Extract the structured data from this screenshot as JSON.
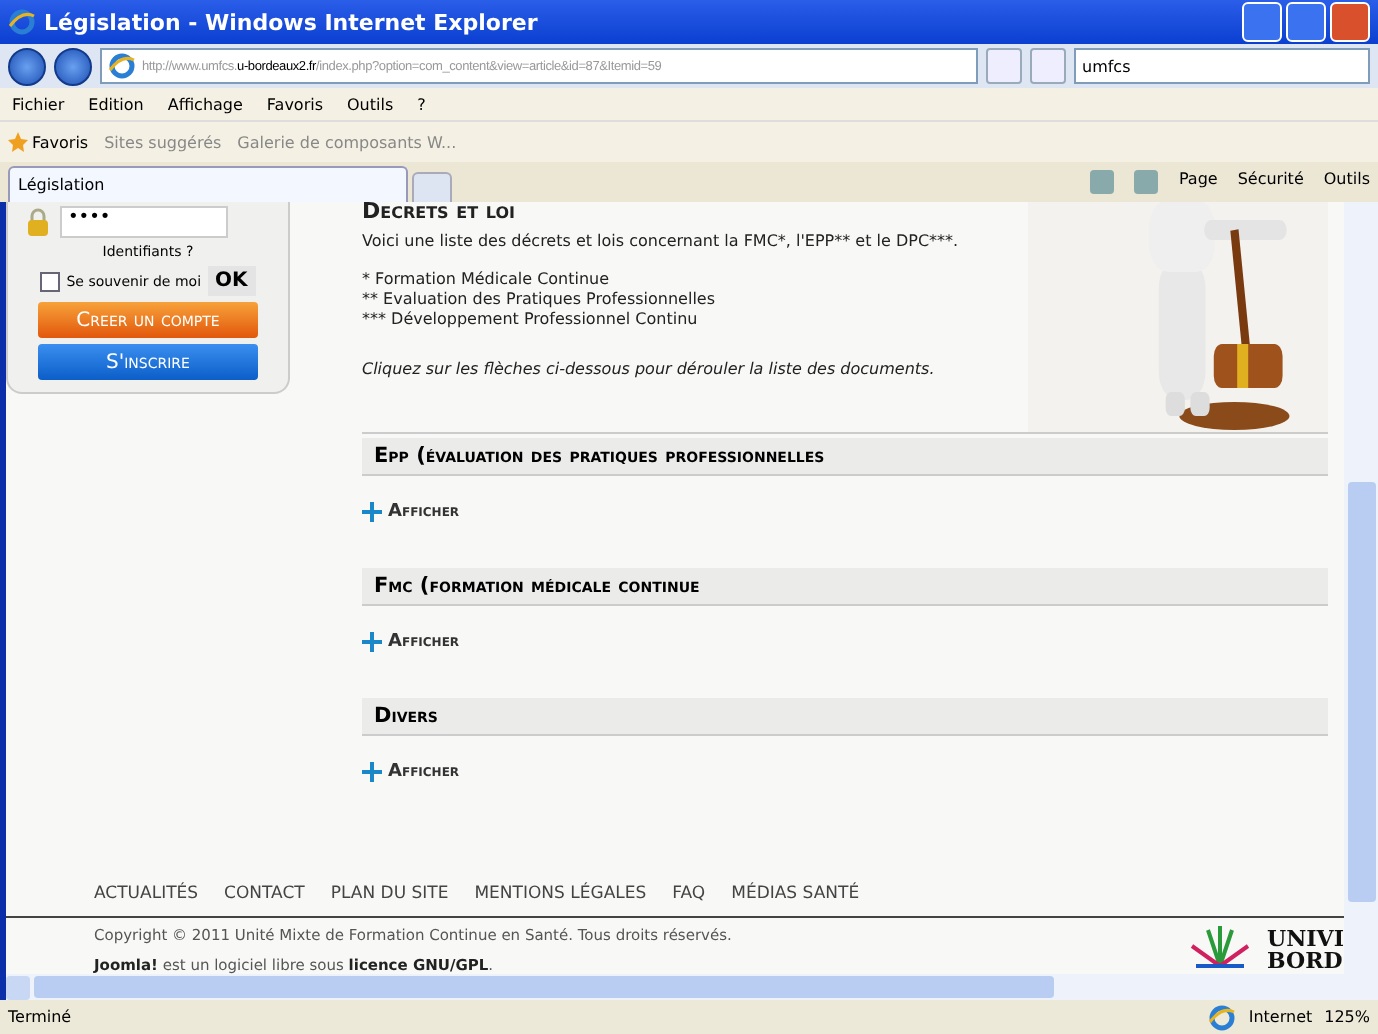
{
  "window": {
    "title": "Législation - Windows Internet Explorer"
  },
  "address": {
    "prefix": "http://www.umfcs.",
    "host": "u-bordeaux2.fr",
    "path": "/index.php?option=com_content&view=article&id=87&Itemid=59"
  },
  "search": {
    "value": "umfcs"
  },
  "menu": [
    "Fichier",
    "Edition",
    "Affichage",
    "Favoris",
    "Outils",
    "?"
  ],
  "favorites_bar": {
    "label": "Favoris",
    "links": [
      {
        "label": "Sites suggérés"
      },
      {
        "label": "Galerie de composants W..."
      }
    ]
  },
  "tabs": [
    {
      "label": "Législation",
      "selected": true
    }
  ],
  "command_bar": [
    "Page",
    "Sécurité",
    "Outils"
  ],
  "login": {
    "password": "••••",
    "forgot": "Identifiants ?",
    "remember": {
      "label": "Se souvenir de moi",
      "checked": false
    },
    "ok": "OK",
    "buttons": [
      {
        "label": "Creer un compte",
        "kind": "orange"
      },
      {
        "label": "S'inscrire",
        "kind": "blue"
      }
    ]
  },
  "article": {
    "title": "Decrets et loi",
    "intro": "Voici une liste des décrets et lois concernant la FMC*, l'EPP** et le DPC***.",
    "notes": [
      "* Formation Médicale Continue",
      "** Evaluation des Pratiques Professionnelles",
      "*** Développement Professionnel Continu"
    ],
    "hint": "Cliquez sur les flèches ci-dessous pour dérouler la liste des documents."
  },
  "sections": [
    {
      "title": "Epp (évaluation des pratiques professionnelles",
      "action": "Afficher"
    },
    {
      "title": "Fmc (formation médicale continue",
      "action": "Afficher"
    },
    {
      "title": "Divers",
      "action": "Afficher"
    }
  ],
  "footer": {
    "links": [
      "ACTUALITÉS",
      "CONTACT",
      "PLAN DU SITE",
      "MENTIONS LÉGALES",
      "FAQ",
      "MÉDIAS SANTÉ"
    ],
    "copyright": "Copyright © 2011 Unité Mixte de Formation Continue en Santé. Tous droits réservés.",
    "license": "**Joomla!** est un logiciel libre sous **licence GNU/GPL**.",
    "logo": [
      "UNIVI",
      "BORD"
    ]
  },
  "status_bar": {
    "text": "Terminé",
    "zone": "Internet",
    "zoom": "125%"
  }
}
